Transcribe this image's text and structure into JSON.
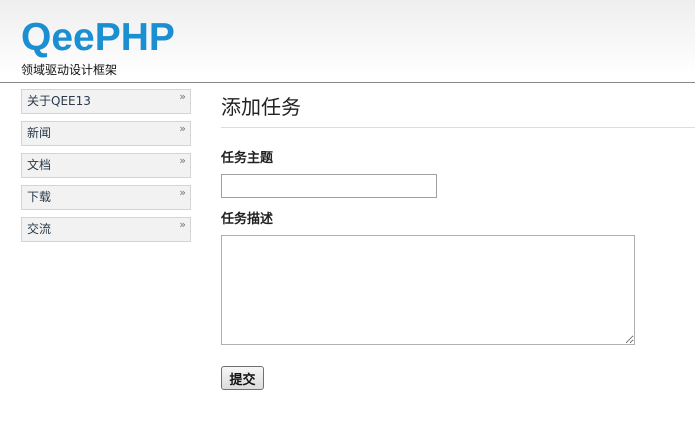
{
  "header": {
    "logo_text": "QeePHP",
    "tagline": "领域驱动设计框架",
    "brand_color": "#1a8fd1"
  },
  "sidebar": {
    "chevron": "»",
    "items": [
      {
        "label": "关于QEE13"
      },
      {
        "label": "新闻"
      },
      {
        "label": "文档"
      },
      {
        "label": "下载"
      },
      {
        "label": "交流"
      }
    ]
  },
  "main": {
    "title": "添加任务",
    "subject_label": "任务主题",
    "subject_value": "",
    "description_label": "任务描述",
    "description_value": "",
    "submit_label": "提交"
  }
}
